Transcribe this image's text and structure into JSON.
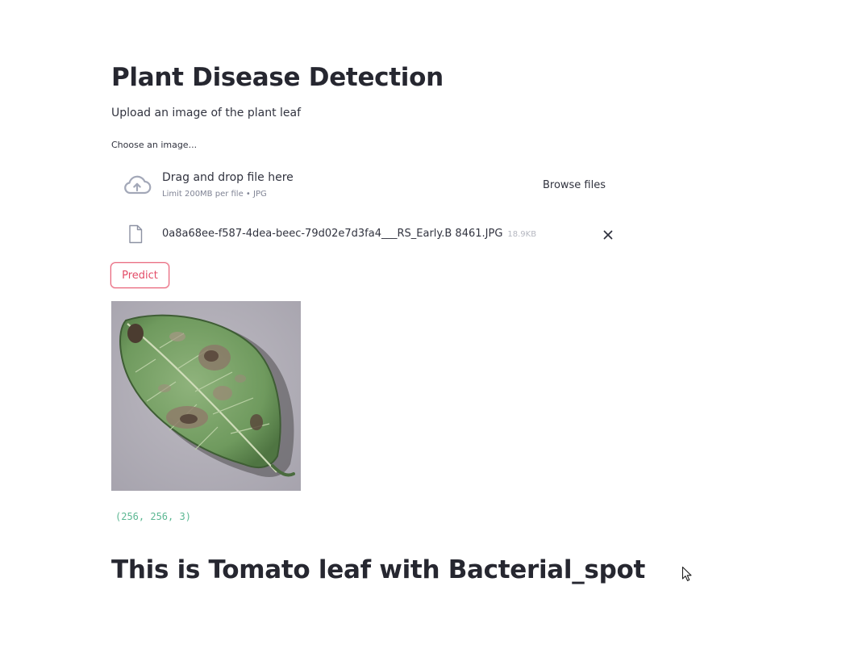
{
  "header": {
    "title": "Plant Disease Detection",
    "subtitle": "Upload an image of the plant leaf"
  },
  "uploader": {
    "label": "Choose an image...",
    "dropzone_text": "Drag and drop file here",
    "limit_text": "Limit 200MB per file • JPG",
    "browse_label": "Browse files",
    "icon": "cloud-upload-icon"
  },
  "uploaded_file": {
    "name": "0a8a68ee-f587-4dea-beec-79d02e7d3fa4___RS_Early.B 8461.JPG",
    "size": "18.9KB",
    "icon": "file-icon",
    "remove_icon": "close-icon"
  },
  "actions": {
    "predict_label": "Predict"
  },
  "output": {
    "image_shape": "(256, 256, 3)",
    "result": "This is Tomato leaf with Bacterial_spot"
  },
  "colors": {
    "accent": "#e34d68",
    "code_text": "#5bb792",
    "heading": "#262730"
  }
}
